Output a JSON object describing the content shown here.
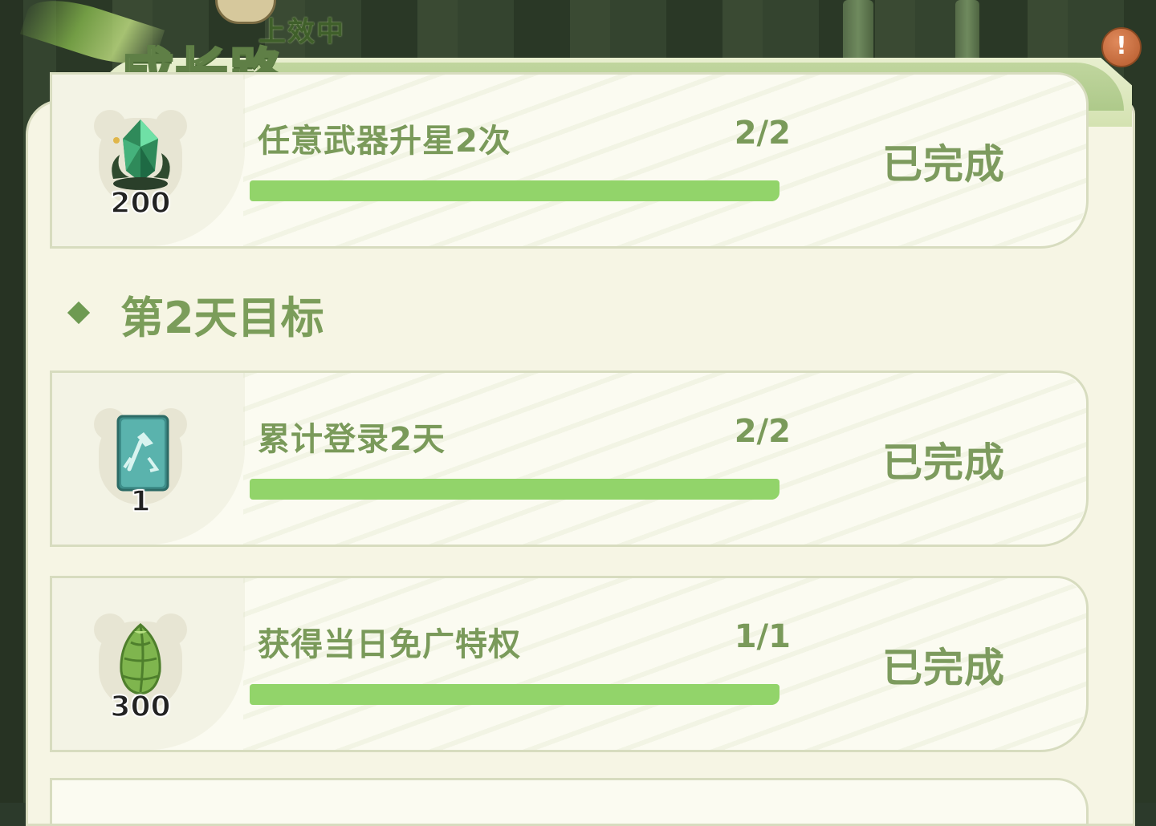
{
  "header": {
    "title": "成长路",
    "status_text": "上效中",
    "alert_symbol": "!"
  },
  "section": {
    "title": "第2天目标"
  },
  "tasks": [
    {
      "name": "任意武器升星2次",
      "progress_text": "2/2",
      "progress": 1.0,
      "status": "已完成",
      "reward_count": "200",
      "reward_icon": "green-crystal-icon"
    },
    {
      "name": "累计登录2天",
      "progress_text": "2/2",
      "progress": 1.0,
      "status": "已完成",
      "reward_count": "1",
      "reward_icon": "axe-card-icon"
    },
    {
      "name": "获得当日免广特权",
      "progress_text": "1/1",
      "progress": 1.0,
      "status": "已完成",
      "reward_count": "300",
      "reward_icon": "bamboo-shoot-icon"
    }
  ],
  "colors": {
    "accent": "#7a9a5a",
    "bar_fill": "#92d46a",
    "panel": "#f6f5e4"
  }
}
